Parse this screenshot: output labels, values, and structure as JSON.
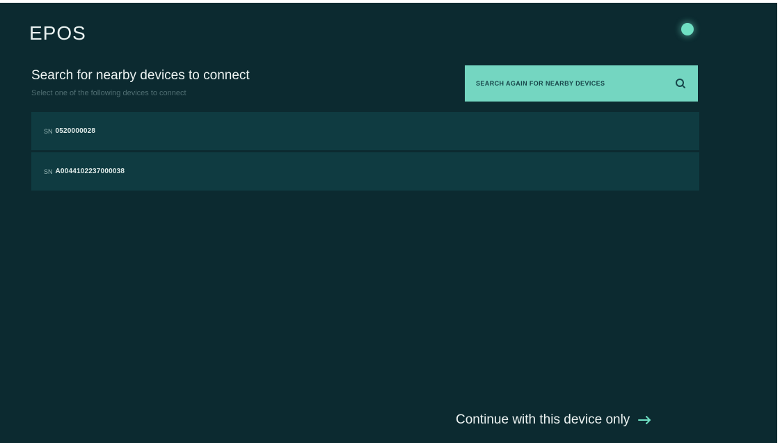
{
  "brand": {
    "logo_text": "EPOS"
  },
  "header": {
    "title": "Search for nearby devices to connect",
    "subtitle": "Select one of the following devices to connect"
  },
  "search_button": {
    "label": "SEARCH AGAIN FOR NEARBY DEVICES",
    "icon": "search-icon"
  },
  "devices": [
    {
      "prefix": "SN",
      "serial": "0520000028"
    },
    {
      "prefix": "SN",
      "serial": "A0044102237000038"
    }
  ],
  "footer": {
    "continue_label": "Continue with this device only",
    "icon": "arrow-right-icon"
  },
  "colors": {
    "background": "#0c2a30",
    "row": "#0f3b41",
    "accent": "#74d6c1",
    "status": "#6fe0c3"
  }
}
